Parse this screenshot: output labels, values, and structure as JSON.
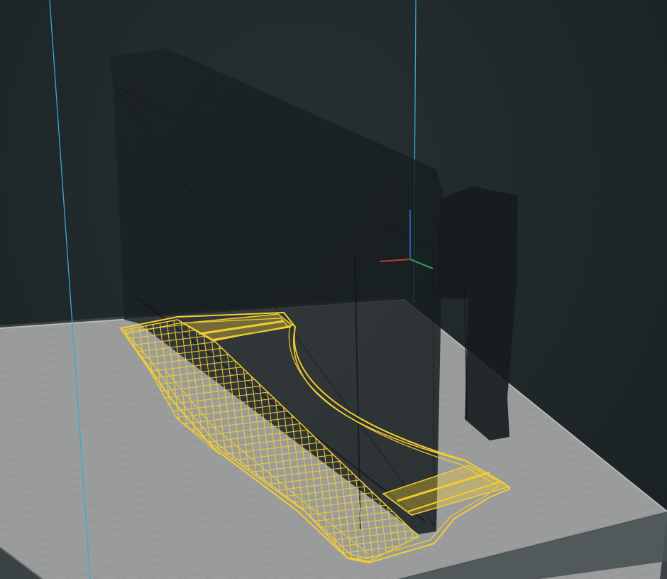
{
  "viewport": {
    "kind": "3d-slicer-layer-preview",
    "background_color": "#1f2729",
    "build_plate_color": "#9a9c9c",
    "build_plate_grid_color": "#8a8d8d",
    "plate_edge_color": "#3e4648",
    "build_volume_line_color": "#3aa7d6",
    "ghost_model_color": "#161c1e",
    "toolpath_color": "#f2cd32",
    "axis_colors": {
      "x": "#c0392b",
      "y": "#27ae60",
      "z": "#2c5aa0"
    },
    "layer_view": {
      "infill_pattern": "grid",
      "shows_ghost_model": true,
      "shows_current_layer": true
    }
  }
}
